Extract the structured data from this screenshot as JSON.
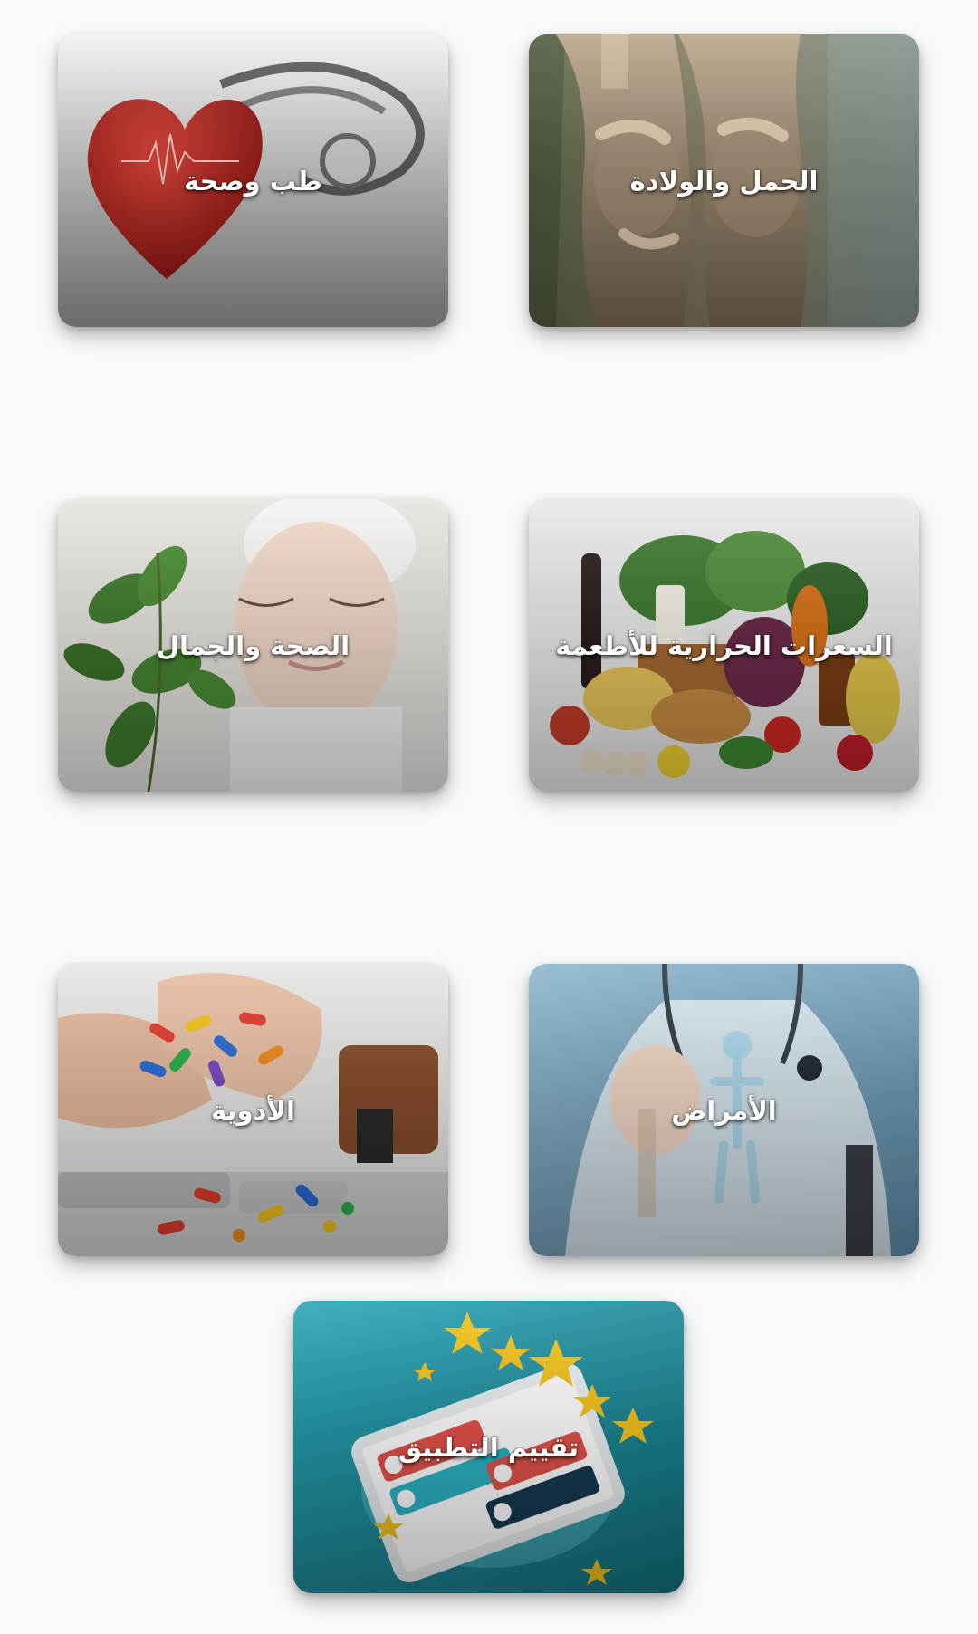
{
  "categories": [
    {
      "id": "pregnancy",
      "label": "الحمل والولادة",
      "image": "pregnant-women-image"
    },
    {
      "id": "medicine_health",
      "label": "طب وصحة",
      "image": "heart-stethoscope-image"
    },
    {
      "id": "calories",
      "label": "السعرات الحرارية للأطعمة",
      "image": "food-vegetables-image"
    },
    {
      "id": "health_beauty",
      "label": "الصحة والجمال",
      "image": "woman-face-mask-image"
    },
    {
      "id": "diseases",
      "label": "الأمراض",
      "image": "doctor-anatomy-image"
    },
    {
      "id": "medications",
      "label": "الأدوية",
      "image": "pills-hands-image"
    }
  ],
  "rate_app": {
    "label": "تقييم التطبيق",
    "image": "phone-stars-rating-image"
  }
}
